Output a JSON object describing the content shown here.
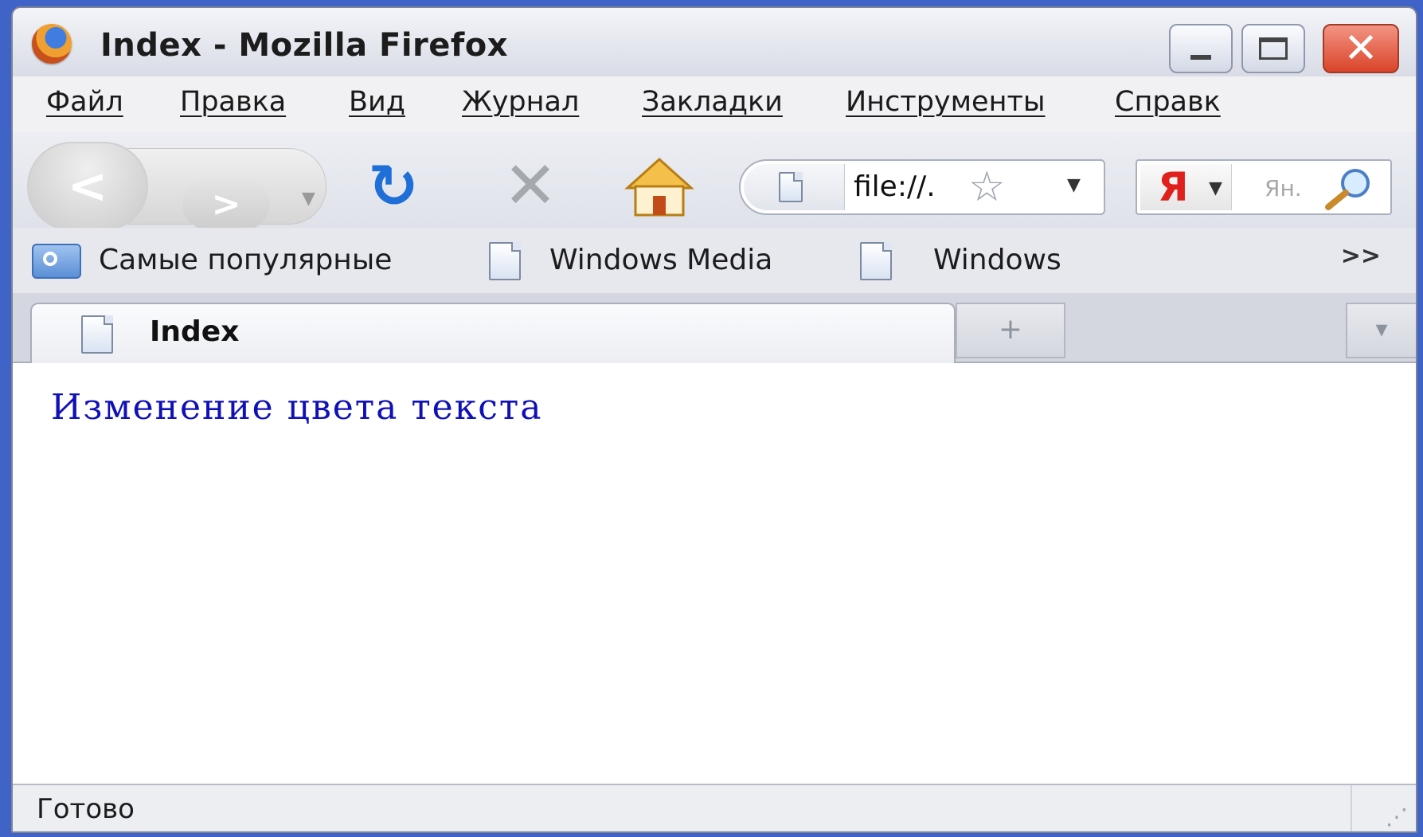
{
  "window": {
    "title": "Index - Mozilla Firefox"
  },
  "menu": {
    "items": [
      {
        "label": "Файл"
      },
      {
        "label": "Правка"
      },
      {
        "label": "Вид"
      },
      {
        "label": "Журнал"
      },
      {
        "label": "Закладки"
      },
      {
        "label": "Инструменты"
      },
      {
        "label": "Справк"
      }
    ]
  },
  "nav": {
    "back_glyph": "<",
    "forward_glyph": ">",
    "url": "file://.",
    "search_engine_logo": "Я",
    "search_placeholder": "Ян."
  },
  "bookmarks": {
    "items": [
      {
        "label": "Самые популярные",
        "icon": "smart-folder-icon"
      },
      {
        "label": "Windows Media",
        "icon": "page-icon"
      },
      {
        "label": "Windows",
        "icon": "page-icon"
      }
    ],
    "overflow": ">>"
  },
  "tabs": [
    {
      "label": "Index",
      "active": true
    }
  ],
  "content": {
    "text": "Изменение цвета текста",
    "text_color": "#1010b8"
  },
  "status": {
    "text": "Готово"
  }
}
